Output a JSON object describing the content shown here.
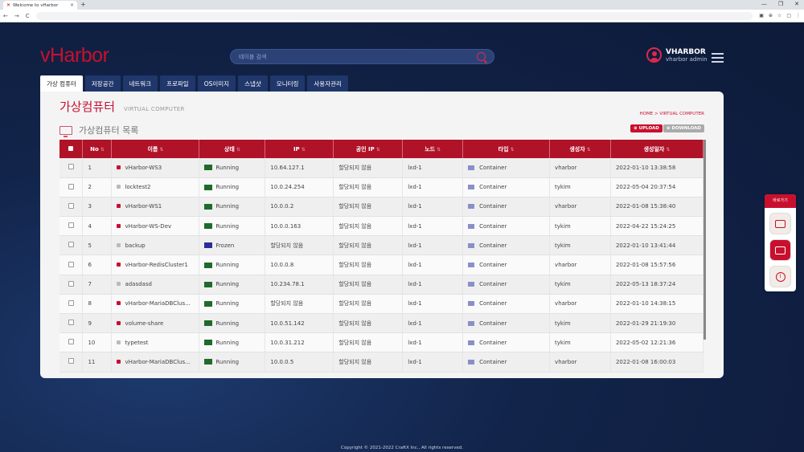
{
  "browser": {
    "tab_title": "Welcome to vHarbor",
    "tab_close": "×",
    "new_tab": "+",
    "nav": {
      "back": "←",
      "forward": "→",
      "reload": "C"
    },
    "window_controls": [
      "—",
      "❐",
      "✕"
    ]
  },
  "app": {
    "logo": "vHarbor",
    "search_placeholder": "테이블 검색",
    "user": {
      "name": "VHARBOR",
      "role": "vharbor admin"
    },
    "nav_tabs": [
      "가상 컴퓨터",
      "저장공간",
      "네트워크",
      "프로파일",
      "OS이미지",
      "스냅샷",
      "모니터링",
      "사용자관리"
    ],
    "active_tab": 0
  },
  "page": {
    "title": "가상컴퓨터",
    "subtitle": "VIRTUAL COMPUTER",
    "breadcrumb": "HOME > VIRTUAL COMPUTER",
    "list_title": "가상컴퓨터 목록",
    "upload_label": "UPLOAD",
    "download_label": "DOWNLOAD",
    "sort_glyph": "⇅"
  },
  "table": {
    "headers": [
      "No",
      "이름",
      "상태",
      "IP",
      "공인 IP",
      "노드",
      "타입",
      "생성자",
      "생성일자"
    ],
    "rows": [
      {
        "no": "1",
        "name": "vHarbor-WS3",
        "lock": "red",
        "status": "Running",
        "ip": "10.64.127.1",
        "public_ip": "할당되지 않음",
        "node": "lxd-1",
        "type": "Container",
        "creator": "vharbor",
        "created": "2022-01-10 13:38:58"
      },
      {
        "no": "2",
        "name": "locktest2",
        "lock": "gray",
        "status": "Running",
        "ip": "10.0.24.254",
        "public_ip": "할당되지 않음",
        "node": "lxd-1",
        "type": "Container",
        "creator": "tykim",
        "created": "2022-05-04 20:37:54"
      },
      {
        "no": "3",
        "name": "vHarbor-WS1",
        "lock": "red",
        "status": "Running",
        "ip": "10.0.0.2",
        "public_ip": "할당되지 않음",
        "node": "lxd-1",
        "type": "Container",
        "creator": "vharbor",
        "created": "2022-01-08 15:38:40"
      },
      {
        "no": "4",
        "name": "vHarbor-WS-Dev",
        "lock": "red",
        "status": "Running",
        "ip": "10.0.0.163",
        "public_ip": "할당되지 않음",
        "node": "lxd-1",
        "type": "Container",
        "creator": "tykim",
        "created": "2022-04-22 15:24:25"
      },
      {
        "no": "5",
        "name": "backup",
        "lock": "gray",
        "status": "Frozen",
        "ip": "할당되지 않음",
        "public_ip": "할당되지 않음",
        "node": "lxd-1",
        "type": "Container",
        "creator": "tykim",
        "created": "2022-01-10 13:41:44"
      },
      {
        "no": "6",
        "name": "vHarbor-RedisCluster1",
        "lock": "red",
        "status": "Running",
        "ip": "10.0.0.8",
        "public_ip": "할당되지 않음",
        "node": "lxd-1",
        "type": "Container",
        "creator": "vharbor",
        "created": "2022-01-08 15:57:56"
      },
      {
        "no": "7",
        "name": "adasdasd",
        "lock": "gray",
        "status": "Running",
        "ip": "10.234.78.1",
        "public_ip": "할당되지 않음",
        "node": "lxd-1",
        "type": "Container",
        "creator": "tykim",
        "created": "2022-05-13 18:37:24"
      },
      {
        "no": "8",
        "name": "vHarbor-MariaDBClus...",
        "lock": "red",
        "status": "Running",
        "ip": "할당되지 않음",
        "public_ip": "할당되지 않음",
        "node": "lxd-1",
        "type": "Container",
        "creator": "vharbor",
        "created": "2022-01-10 14:38:15"
      },
      {
        "no": "9",
        "name": "volume-share",
        "lock": "red",
        "status": "Running",
        "ip": "10.0.51.142",
        "public_ip": "할당되지 않음",
        "node": "lxd-1",
        "type": "Container",
        "creator": "tykim",
        "created": "2022-01-29 21:19:30"
      },
      {
        "no": "10",
        "name": "typetest",
        "lock": "gray",
        "status": "Running",
        "ip": "10.0.31.212",
        "public_ip": "할당되지 않음",
        "node": "lxd-1",
        "type": "Container",
        "creator": "tykim",
        "created": "2022-05-02 12:21:36"
      },
      {
        "no": "11",
        "name": "vHarbor-MariaDBClus...",
        "lock": "red",
        "status": "Running",
        "ip": "10.0.0.5",
        "public_ip": "할당되지 않음",
        "node": "lxd-1",
        "type": "Container",
        "creator": "vharbor",
        "created": "2022-01-08 16:00:03"
      }
    ]
  },
  "quick_menu": {
    "title": "바로가기",
    "info_glyph": "i"
  },
  "footer": "Copyright © 2021-2022 CraftX Inc., All rights reserved.",
  "colors": {
    "brand": "#c8102e",
    "running": "#1f6b2b",
    "frozen": "#2a2e9a"
  }
}
